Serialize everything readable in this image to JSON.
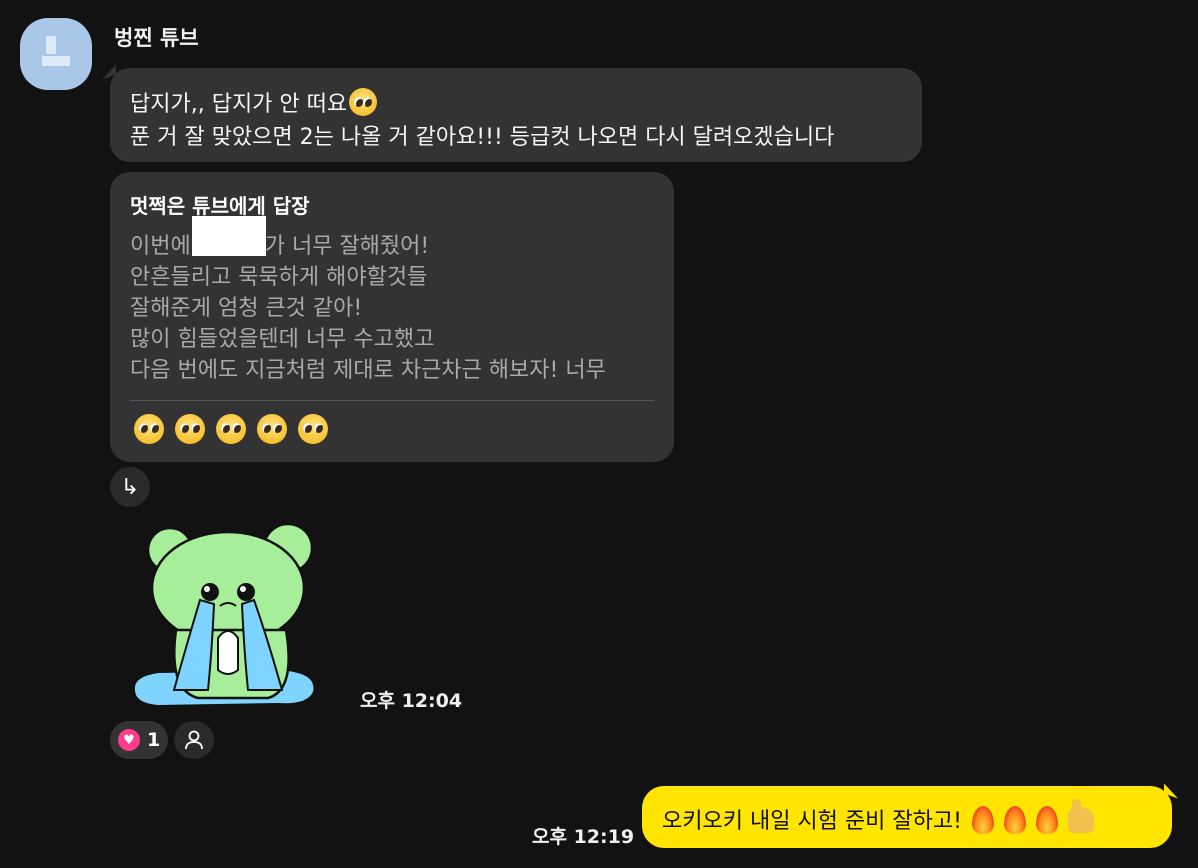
{
  "sender": {
    "name": "벙찐 튜브"
  },
  "message1": {
    "line1": "답지가,, 답지가 안 떠요",
    "line1_emoji": "pleading-face",
    "line2": "푼 거 잘 맞았으면 2는 나올 거 같아요!!! 등급컷 나오면 다시 달려오겠습니다"
  },
  "message2": {
    "reply_title": "멋쩍은 튜브에게 답장",
    "line1_prefix": "이번에",
    "line1_suffix": "가 너무 잘해줬어!",
    "line2": "안흔들리고 묵묵하게 해야할것들",
    "line3": "잘해준게 엄청 큰것 같아!",
    "line4": "많이 힘들었을텐데 너무 수고했고",
    "line5": "다음 번에도 지금처럼 제대로 차근차근 해보자! 너무",
    "emoji_row": [
      "pleading-face",
      "pleading-face",
      "pleading-face",
      "pleading-face",
      "pleading-face"
    ]
  },
  "reply_button": {
    "icon": "reply-arrow-icon",
    "glyph": "↳"
  },
  "sticker": {
    "icon": "crying-bear-sticker"
  },
  "time1": "오후 12:04",
  "reaction": {
    "icon": "heart-icon",
    "count": "1",
    "color": "#ff3b8d"
  },
  "my_message": {
    "text": "오키오키 내일 시험 준비 잘하고!",
    "emojis": [
      "fire",
      "fire",
      "fire",
      "thumbs-up"
    ],
    "bubble_color": "#ffe500"
  },
  "time2": "오후 12:19"
}
